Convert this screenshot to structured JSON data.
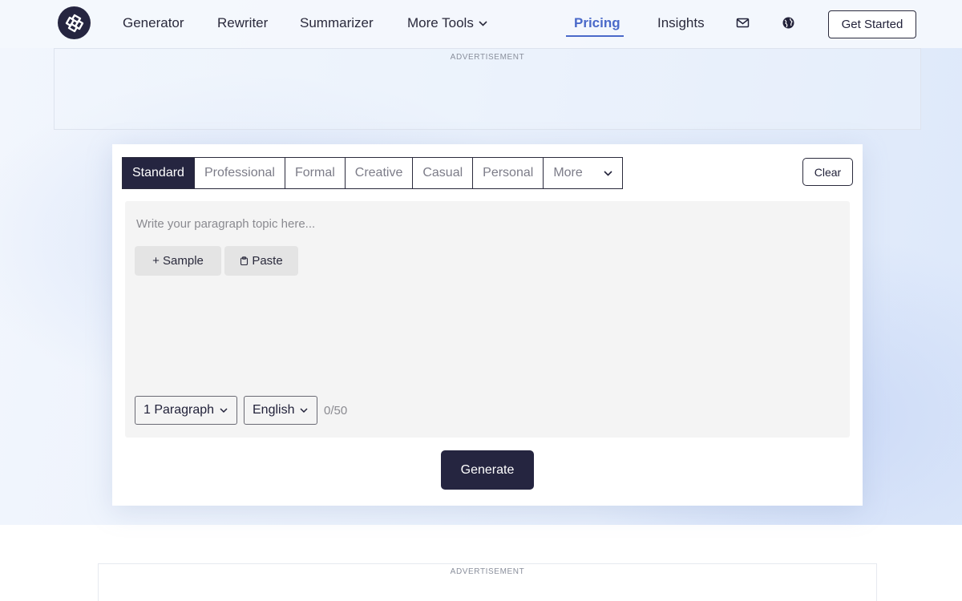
{
  "nav": {
    "links": [
      "Generator",
      "Rewriter",
      "Summarizer",
      "More Tools",
      "Pricing",
      "Insights"
    ],
    "active": "Pricing",
    "cta": "Get Started",
    "icons": [
      "logo-icon",
      "mail-icon",
      "globe-icon",
      "chevron-down-icon"
    ]
  },
  "ads": {
    "label": "ADVERTISEMENT"
  },
  "tool": {
    "tabs": [
      "Standard",
      "Professional",
      "Formal",
      "Creative",
      "Casual",
      "Personal"
    ],
    "selected_tab": "Standard",
    "more_label": "More",
    "clear_label": "Clear",
    "topic_placeholder": "Write your paragraph topic here...",
    "topic_value": "",
    "sample_label": "+ Sample",
    "paste_label": "Paste",
    "length_select": "1 Paragraph",
    "language_select": "English",
    "counter": "0/50",
    "generate_label": "Generate"
  },
  "colors": {
    "primary_dark": "#252540",
    "active_link": "#4a69c9",
    "editor_bg": "#f4f4f4"
  }
}
